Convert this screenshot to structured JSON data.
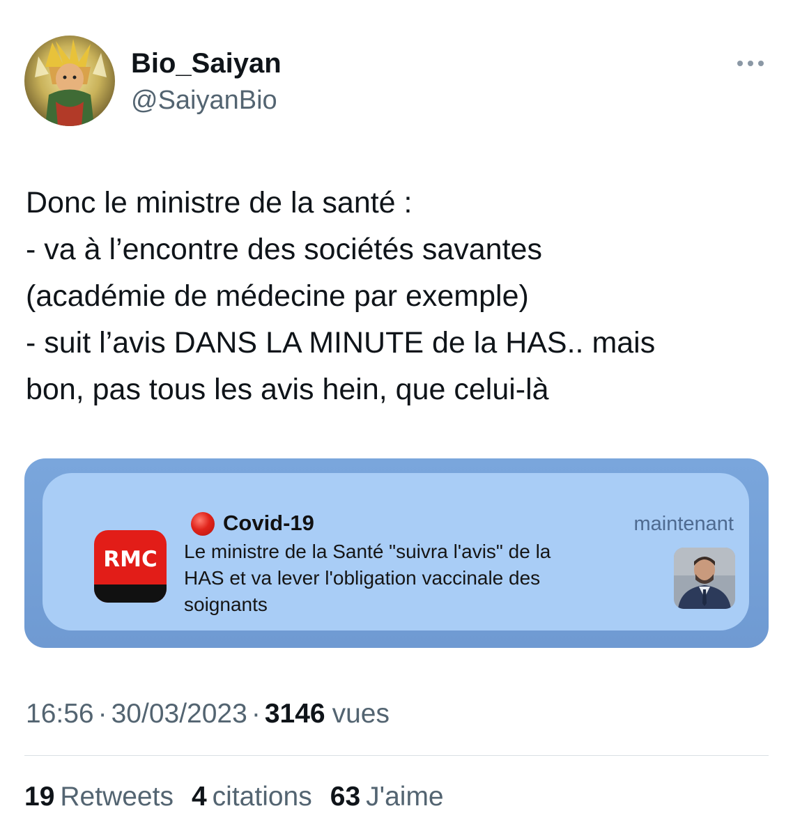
{
  "tweet": {
    "author": {
      "display_name": "Bio_Saiyan",
      "handle": "@SaiyanBio",
      "avatar_icon": "anime-avatar"
    },
    "more_icon": "more-options-icon",
    "text_lines": [
      "Donc le ministre de la santé :",
      "- va à l’encontre des sociétés savantes",
      "(académie de médecine par exemple)",
      "- suit l’avis DANS LA MINUTE de la HAS.. mais",
      "bon, pas tous les avis hein, que celui-là"
    ],
    "media": {
      "notification": {
        "app_logo_text": "RMC",
        "app_logo_color": "#e21d18",
        "status_icon": "red-circle-icon",
        "title": "Covid-19",
        "time": "maintenant",
        "body_lines": [
          "Le ministre de la Santé \"suivra l'avis\" de la",
          "HAS et va lever l'obligation vaccinale des",
          "soignants"
        ],
        "thumbnail": "minister-portrait"
      },
      "background_color": "#7aa6dc",
      "card_color": "#a9cdf6"
    },
    "meta": {
      "time": "16:56",
      "separator": "·",
      "date": "30/03/2023",
      "views_count": "3146",
      "views_label": "vues"
    },
    "stats": {
      "retweets": {
        "count": "19",
        "label": "Retweets"
      },
      "quotes": {
        "count": "4",
        "label": "citations"
      },
      "likes": {
        "count": "63",
        "label": "J'aime"
      }
    }
  }
}
